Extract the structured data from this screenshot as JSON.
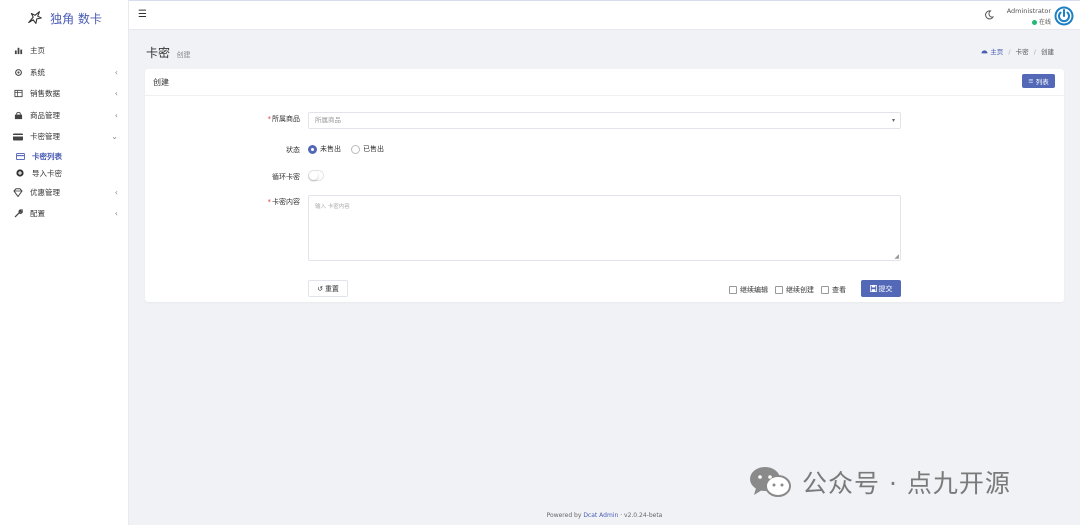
{
  "brand": {
    "name": "独角 数卡"
  },
  "sidebar": {
    "items": [
      {
        "label": "主页",
        "icon": "bar-chart-icon",
        "has_chevron": false
      },
      {
        "label": "系统",
        "icon": "gear-icon",
        "has_chevron": true,
        "chevron": "‹"
      },
      {
        "label": "销售数据",
        "icon": "table-icon",
        "has_chevron": true,
        "chevron": "‹"
      },
      {
        "label": "商品管理",
        "icon": "shopping-bag-icon",
        "has_chevron": true,
        "chevron": "‹"
      },
      {
        "label": "卡密管理",
        "icon": "credit-card-icon",
        "has_chevron": true,
        "chevron": "⌄"
      }
    ],
    "subitems": [
      {
        "label": "卡密列表",
        "icon": "card-icon",
        "active": true
      },
      {
        "label": "导入卡密",
        "icon": "plus-circle-icon",
        "active": false
      }
    ],
    "items2": [
      {
        "label": "优惠管理",
        "icon": "diamond-icon",
        "chevron": "‹"
      },
      {
        "label": "配置",
        "icon": "wrench-icon",
        "chevron": "‹"
      }
    ]
  },
  "topbar": {
    "menu_icon": "☰",
    "user_name": "Administrator",
    "user_status": "在线"
  },
  "header": {
    "title": "卡密",
    "subtitle": "创建",
    "breadcrumb": {
      "home": "主页",
      "sep": "/",
      "item1": "卡密",
      "item2": "创建"
    }
  },
  "card": {
    "title": "创建",
    "list_button": "列表"
  },
  "form": {
    "product_label": "所属商品",
    "product_placeholder": "所属商品",
    "status_label": "状态",
    "status_options": [
      "未售出",
      "已售出"
    ],
    "status_selected": 0,
    "loop_label": "循环卡密",
    "loop_on": false,
    "content_label": "卡密内容",
    "content_placeholder": "输入 卡密内容",
    "reset_button": "重置",
    "checks": [
      "继续编辑",
      "继续创建",
      "查看"
    ],
    "submit_button": "提交"
  },
  "footer": {
    "prefix": "Powered by ",
    "link": "Dcat Admin",
    "sep": " · ",
    "version": "v2.0.24-beta"
  },
  "watermark": {
    "text": "公众号 · 点九开源"
  },
  "colors": {
    "accent": "#5468b8",
    "online": "#21b978",
    "required": "#e04040"
  }
}
